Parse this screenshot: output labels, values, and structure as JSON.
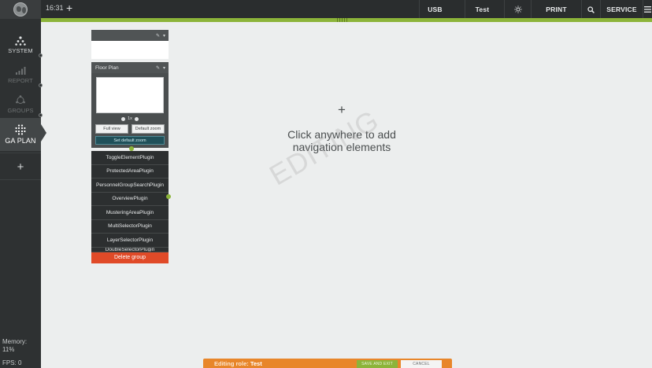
{
  "topbar": {
    "time": "16:31",
    "add_label": "+",
    "items": [
      {
        "id": "usb",
        "label": "USB"
      },
      {
        "id": "test",
        "label": "Test"
      },
      {
        "id": "brightness",
        "icon": "sun-icon"
      },
      {
        "id": "print",
        "label": "PRINT"
      },
      {
        "id": "search",
        "icon": "search-icon"
      },
      {
        "id": "service",
        "label": "SERVICE"
      },
      {
        "id": "menu",
        "icon": "hamburger-menu-icon"
      }
    ]
  },
  "sidebar": {
    "items": [
      {
        "label": "SYSTEM",
        "icon": "system-tree-icon"
      },
      {
        "label": "REPORT",
        "icon": "bar-chart-icon"
      },
      {
        "label": "GROUPS",
        "icon": "groups-icon"
      },
      {
        "label": "GA PLAN",
        "icon": "grid-dots-icon"
      }
    ],
    "add_label": "+",
    "memory_label": "Memory:",
    "memory_value": "11%",
    "fps_label": "FPS: 0"
  },
  "panel": {
    "top_header_title": "",
    "floor_plan": {
      "title": "Floor Plan",
      "zoom_text": "1x",
      "full_view_label": "Full view",
      "default_zoom_label": "Default zoom",
      "set_default_zoom_label": "Set default zoom"
    },
    "plugins": [
      "ToggleElementPlugin",
      "ProtectedAreaPlugin",
      "PersonnelGroupSearchPlugin",
      "OverviewPlugin",
      "MusteringAreaPlugin",
      "MultiSelectorPlugin",
      "LayerSelectorPlugin",
      "DoubleSelectorPlugin"
    ],
    "delete_label": "Delete group"
  },
  "canvas": {
    "plus": "+",
    "hint_line1": "Click anywhere to add",
    "hint_line2": "navigation elements",
    "watermark": "EDITING"
  },
  "editbar": {
    "role_prefix": "Editing role:",
    "role_name": "Test",
    "save_label": "SAVE AND EXIT",
    "cancel_label": "CANCEL"
  },
  "colors": {
    "accent_green": "#8cb43a",
    "delete_red": "#e04a28",
    "edit_orange": "#e8862a"
  }
}
